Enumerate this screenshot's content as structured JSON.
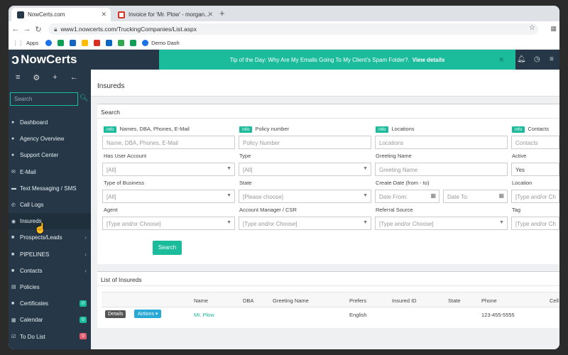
{
  "browser": {
    "tabs": [
      {
        "title": "NowCerts.com"
      },
      {
        "title": "Invoice for 'Mr. Plow' - morgan..."
      }
    ],
    "url": "www1.nowcerts.com/TruckingCompanies/List.aspx",
    "bookmarks": [
      "Apps",
      "Demo Dash"
    ]
  },
  "app": {
    "logo": "NowCerts",
    "tip_text": "Tip of the Day: Why Are My Emails Going To My Client's Spam Folder?.",
    "tip_link": "View details"
  },
  "sidebar": {
    "search_placeholder": "Search",
    "items": [
      {
        "label": "Dashboard",
        "icon": "dashboard-icon"
      },
      {
        "label": "Agency Overview",
        "icon": "overview-icon"
      },
      {
        "label": "Support Center",
        "icon": "support-icon"
      },
      {
        "label": "E-Mail",
        "icon": "email-icon"
      },
      {
        "label": "Text Messaging / SMS",
        "icon": "sms-icon"
      },
      {
        "label": "Call Logs",
        "icon": "phone-icon"
      },
      {
        "label": "Insureds",
        "icon": "eye-icon"
      },
      {
        "label": "Prospects/Leads",
        "icon": "folder-icon"
      },
      {
        "label": "PIPELINES",
        "icon": "folder-icon"
      },
      {
        "label": "Contacts",
        "icon": "folder-icon"
      },
      {
        "label": "Policies",
        "icon": "document-icon"
      },
      {
        "label": "Certificates",
        "icon": "certificate-icon",
        "badge": "0",
        "badge_color": "#1abc9c"
      },
      {
        "label": "Calendar",
        "icon": "calendar-icon",
        "badge": "0",
        "badge_color": "#1abc9c"
      },
      {
        "label": "To Do List",
        "icon": "checkbox-icon",
        "badge": "0",
        "badge_color": "#e05b6f"
      }
    ]
  },
  "page": {
    "title": "Insureds",
    "search_panel": {
      "title": "Search",
      "info_label": "info",
      "fields": {
        "names": {
          "label": "Names, DBA, Phones, E-Mail",
          "placeholder": "Name, DBA, Phones, E-Mail"
        },
        "policy": {
          "label": "Policy number",
          "placeholder": "Policy Number"
        },
        "locations": {
          "label": "Locations",
          "placeholder": "Locations"
        },
        "contacts": {
          "label": "Contacts",
          "placeholder": "Contacts"
        },
        "user_account": {
          "label": "Has User Account",
          "value": "[All]"
        },
        "type": {
          "label": "Type",
          "value": "[All]"
        },
        "greeting": {
          "label": "Greeting Name",
          "placeholder": "Greeting Name"
        },
        "active": {
          "label": "Active",
          "value": "Yes"
        },
        "type_business": {
          "label": "Type of Business",
          "value": "[All]"
        },
        "state": {
          "label": "State",
          "value": "[Please choose]"
        },
        "create_date": {
          "label": "Create Date (from - to)",
          "from": "Date From:",
          "to": "Date To:"
        },
        "location": {
          "label": "Location",
          "value": "[Type and/or Ch"
        },
        "agent": {
          "label": "Agent",
          "value": "[Type and/or Choose]"
        },
        "manager": {
          "label": "Account Manager / CSR",
          "value": "[Type and/or Choose]"
        },
        "referral": {
          "label": "Referral Source",
          "value": "[Type and/or Choose]"
        },
        "tag": {
          "label": "Tag",
          "value": "[Type and/or Ch"
        }
      },
      "search_button": "Search"
    },
    "list_panel": {
      "title": "List of Insureds",
      "columns": [
        "Name",
        "DBA",
        "Greeting Name",
        "Prefers",
        "Insured ID",
        "State",
        "Phone",
        "Cell"
      ],
      "rows": [
        {
          "details": "Details",
          "actions": "Actions",
          "name": "Mr. Plow",
          "prefers": "English",
          "phone": "123-455-5555"
        }
      ]
    }
  }
}
